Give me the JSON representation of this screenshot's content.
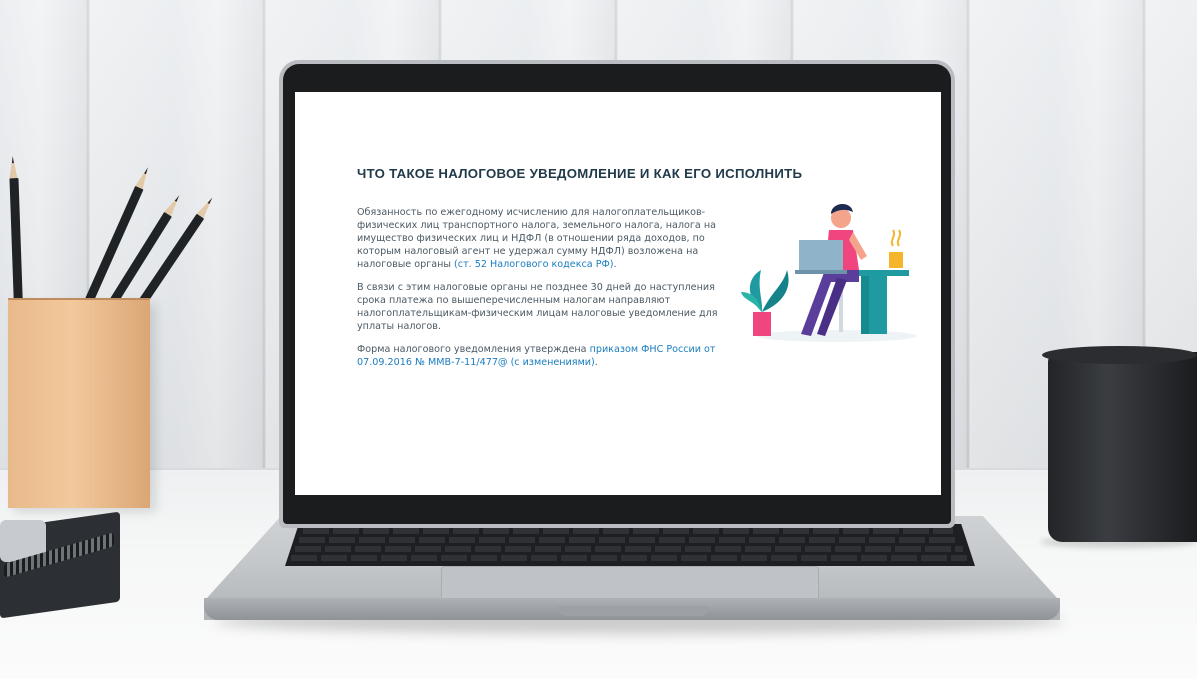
{
  "page": {
    "title": "ЧТО ТАКОЕ НАЛОГОВОЕ УВЕДОМЛЕНИЕ И КАК ЕГО ИСПОЛНИТЬ",
    "paragraph1": "Обязанность по ежегодному исчислению для налогоплательщиков-физических лиц транспортного налога, земельного налога, налога на имущество физических лиц и НДФЛ (в отношении ряда доходов, по которым налоговый агент не удержал сумму НДФЛ) возложена на налоговые органы",
    "paragraph1_link": "(ст. 52 Налогового кодекса РФ)",
    "paragraph1_end": ".",
    "paragraph2": "В связи с этим налоговые органы не позднее 30 дней до наступления срока платежа по вышеперечисленным налогам направляют налогоплательщикам-физическим лицам налоговые уведомление для уплаты налогов.",
    "paragraph3": "Форма налогового уведомления утверждена",
    "paragraph3_link": "приказом ФНС России от 07.09.2016 № ММВ-7-11/477@ (с изменениями)",
    "paragraph3_end": "."
  },
  "colors": {
    "title": "#213a4a",
    "text": "#4b5963",
    "link": "#1a7dbf",
    "accent_teal": "#1f9aa0",
    "accent_pink": "#f0457e"
  },
  "illustration": {
    "icon": "person-at-laptop-illustration"
  }
}
